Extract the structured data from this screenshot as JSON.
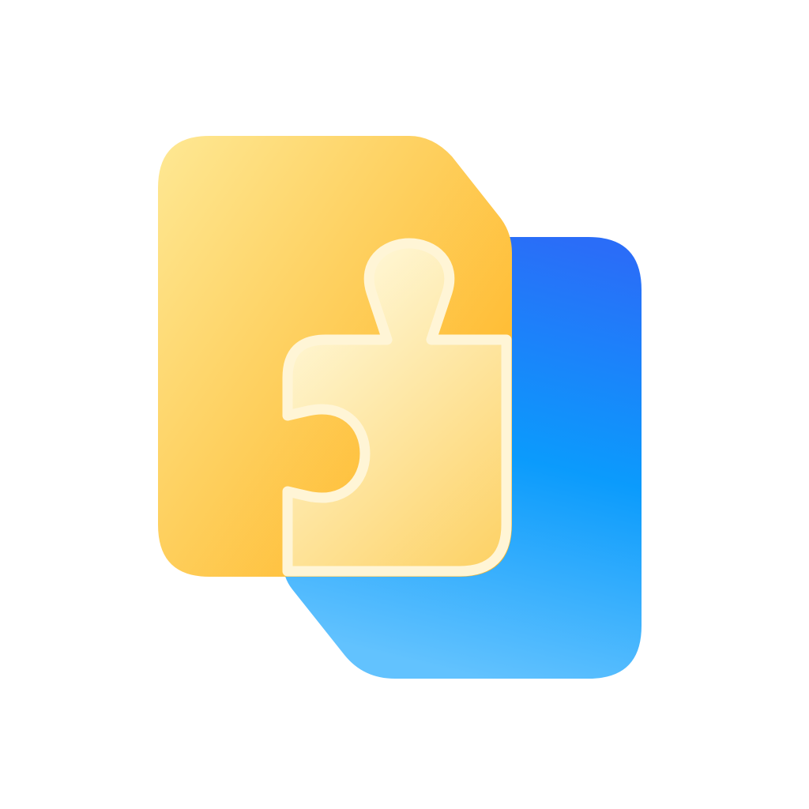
{
  "icon": {
    "name": "puzzle-document-icon",
    "background": "#ffffff",
    "colors": {
      "blue_top": "#2a6df8",
      "blue_mid": "#0b9bfc",
      "blue_bottom": "#62c2fe",
      "yellow_light": "#fee894",
      "yellow_dark": "#ffb31f",
      "piece_light": "#fff8d8",
      "piece_dark": "#fdd36a",
      "piece_outline": "#fff5d6"
    }
  }
}
